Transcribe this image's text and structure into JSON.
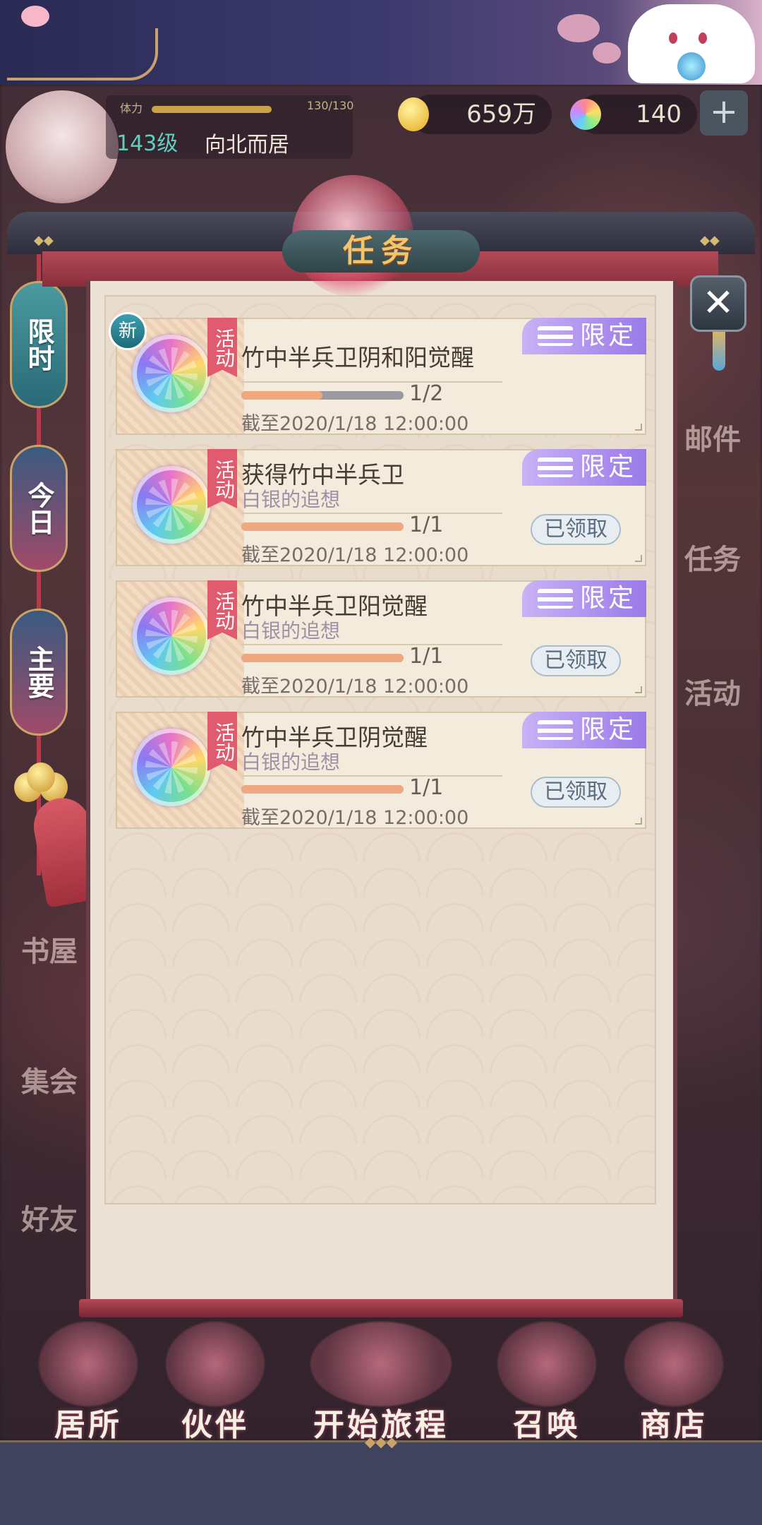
{
  "hud": {
    "stamina_label": "体力",
    "stamina_value": "130/130",
    "stamina_fraction": 1.0,
    "level": "143级",
    "player_name": "向北而居",
    "coins": "659万",
    "jade": "140",
    "plus": "+"
  },
  "panel": {
    "title": "任务",
    "close": "✕"
  },
  "side_tabs": [
    {
      "label": "限时",
      "active": true
    },
    {
      "label": "今日",
      "active": false
    },
    {
      "label": "主要",
      "active": false
    }
  ],
  "tasks": [
    {
      "is_new": true,
      "new_label": "新",
      "ribbon": "活动",
      "title": "竹中半兵卫阴和阳觉醒",
      "subtitle": "",
      "progress_text": "1/2",
      "progress": 0.5,
      "deadline": "截至2020/1/18 12:00:00",
      "tag": "限定",
      "status_button": ""
    },
    {
      "is_new": false,
      "new_label": "",
      "ribbon": "活动",
      "title": "获得竹中半兵卫",
      "subtitle": "白银的追想",
      "progress_text": "1/1",
      "progress": 1.0,
      "deadline": "截至2020/1/18 12:00:00",
      "tag": "限定",
      "status_button": "已领取"
    },
    {
      "is_new": false,
      "new_label": "",
      "ribbon": "活动",
      "title": "竹中半兵卫阳觉醒",
      "subtitle": "白银的追想",
      "progress_text": "1/1",
      "progress": 1.0,
      "deadline": "截至2020/1/18 12:00:00",
      "tag": "限定",
      "status_button": "已领取"
    },
    {
      "is_new": false,
      "new_label": "",
      "ribbon": "活动",
      "title": "竹中半兵卫阴觉醒",
      "subtitle": "白银的追想",
      "progress_text": "1/1",
      "progress": 1.0,
      "deadline": "截至2020/1/18 12:00:00",
      "tag": "限定",
      "status_button": "已领取"
    }
  ],
  "background_labels": [
    "邮件",
    "任务",
    "活动",
    "书屋",
    "集会",
    "好友"
  ],
  "bottom_nav": [
    {
      "label": "居所"
    },
    {
      "label": "伙伴"
    },
    {
      "label": "开始旅程"
    },
    {
      "label": "召唤"
    },
    {
      "label": "商店"
    }
  ],
  "colors": {
    "accent_red": "#e15b6e",
    "limited_purple": "#9a7ae8",
    "progress_fill": "#f0a880",
    "title_gold": "#f3c46a"
  }
}
